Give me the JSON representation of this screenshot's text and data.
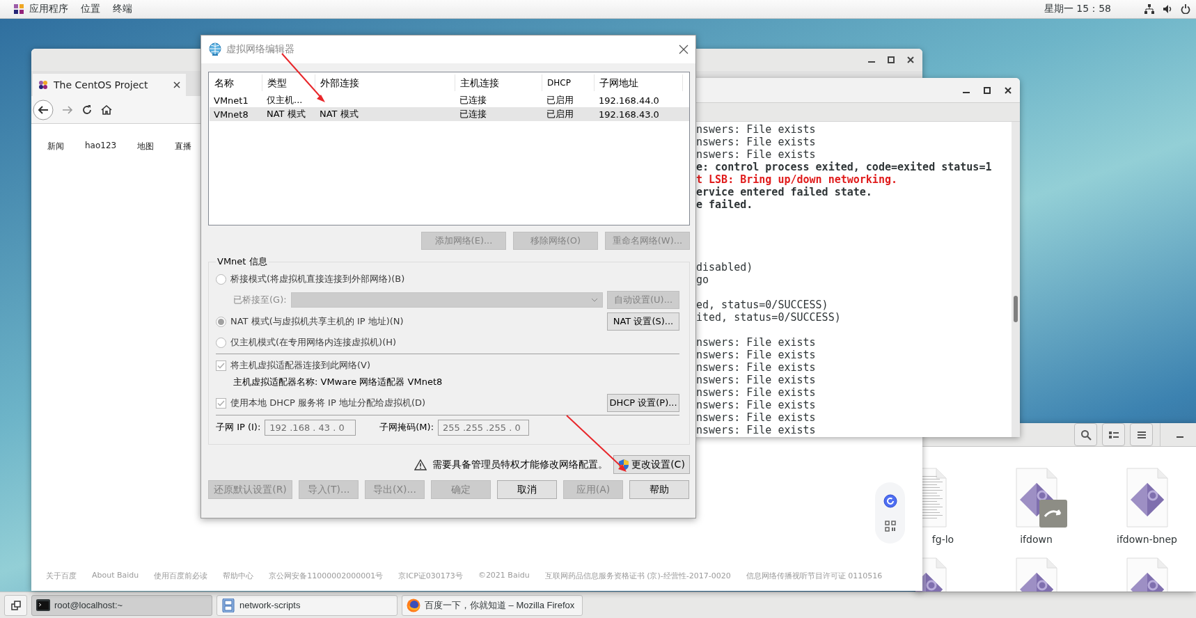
{
  "top_bar": {
    "menus": [
      "应用程序",
      "位置",
      "终端"
    ],
    "clock": "星期一 15：58"
  },
  "browser": {
    "tabs": [
      {
        "label": "The CentOS Project",
        "selected": true
      }
    ],
    "links": [
      "新闻",
      "hao123",
      "地图",
      "直播"
    ],
    "footer_links": [
      "关于百度",
      "About Baidu",
      "使用百度前必读",
      "帮助中心",
      "京公网安备11000002000001号",
      "京ICP证030173号",
      "©2021 Baidu",
      "互联网药品信息服务资格证书 (京)-经营性-2017-0020",
      "信息网络传播视听节目许可证 0110516"
    ]
  },
  "terminal": {
    "lines": [
      {
        "kind": "normal",
        "text": "nswers: File exists"
      },
      {
        "kind": "normal",
        "text": "nswers: File exists"
      },
      {
        "kind": "normal",
        "text": "nswers: File exists"
      },
      {
        "kind": "bold",
        "text": "e: control process exited, code=exited status=1"
      },
      {
        "kind": "error",
        "text": "t LSB: Bring up/down networking."
      },
      {
        "kind": "bold",
        "text": "ervice entered failed state."
      },
      {
        "kind": "bold",
        "text": "e failed."
      },
      {
        "kind": "blank"
      },
      {
        "kind": "blank"
      },
      {
        "kind": "blank"
      },
      {
        "kind": "blank"
      },
      {
        "kind": "normal",
        "text": "disabled)"
      },
      {
        "kind": "normal",
        "text": "go"
      },
      {
        "kind": "blank"
      },
      {
        "kind": "normal",
        "text": "ed, status=0/SUCCESS)"
      },
      {
        "kind": "normal",
        "text": "ited, status=0/SUCCESS)"
      },
      {
        "kind": "blank"
      },
      {
        "kind": "normal",
        "text": "nswers: File exists"
      },
      {
        "kind": "normal",
        "text": "nswers: File exists"
      },
      {
        "kind": "normal",
        "text": "nswers: File exists"
      },
      {
        "kind": "normal",
        "text": "nswers: File exists"
      },
      {
        "kind": "normal",
        "text": "nswers: File exists"
      },
      {
        "kind": "normal",
        "text": "nswers: File exists"
      },
      {
        "kind": "normal",
        "text": "nswers: File exists"
      },
      {
        "kind": "normal",
        "text": "nswers: File exists"
      }
    ]
  },
  "file_manager": {
    "items": [
      {
        "kind": "text",
        "label": "fg-lo"
      },
      {
        "kind": "link",
        "label": "ifdown"
      },
      {
        "kind": "script",
        "label": "ifdown-bnep"
      }
    ]
  },
  "dialog": {
    "title": "虚拟网络编辑器",
    "table": {
      "columns": [
        "名称",
        "类型",
        "外部连接",
        "主机连接",
        "DHCP",
        "子网地址"
      ],
      "rows": [
        {
          "name": "VMnet1",
          "type": "仅主机...",
          "host": "已连接",
          "dhcp": "已启用",
          "subnet": "192.168.44.0",
          "selected": false
        },
        {
          "name": "VMnet8",
          "type": "NAT 模式",
          "external": "NAT 模式",
          "host": "已连接",
          "dhcp": "已启用",
          "subnet": "192.168.43.0",
          "selected": true
        }
      ]
    },
    "list_buttons": [
      {
        "label": "添加网络(E)...",
        "disabled": true
      },
      {
        "label": "移除网络(O)",
        "disabled": true
      },
      {
        "label": "重命名网络(W)...",
        "disabled": true
      }
    ],
    "group": {
      "title": "VMnet 信息",
      "modes": [
        {
          "label": "桥接模式(将虚拟机直接连接到外部网络)(B)",
          "selected": false
        },
        {
          "label": "NAT 模式(与虚拟机共享主机的 IP 地址)(N)",
          "selected": true
        },
        {
          "label": "仅主机模式(在专用网络内连接虚拟机)(H)",
          "selected": false
        }
      ],
      "bridge_label": "已桥接至(G):",
      "bridge_disabled": true,
      "auto_button": {
        "label": "自动设置(U)...",
        "disabled": true
      },
      "nat_button": {
        "label": "NAT 设置(S)...",
        "disabled": false
      },
      "host_adapter": {
        "label": "将主机虚拟适配器连接到此网络(V)",
        "checked": true,
        "disabled": true
      },
      "adapter_name": "主机虚拟适配器名称: VMware 网络适配器 VMnet8",
      "dhcp": {
        "label": "使用本地 DHCP 服务将 IP 地址分配给虚拟机(D)",
        "checked": true,
        "disabled": true
      },
      "dhcp_button": {
        "label": "DHCP 设置(P)...",
        "disabled": false
      },
      "subnet_ip": {
        "label": "子网 IP (I):",
        "value": "192 .168 . 43 . 0"
      },
      "subnet_mask": {
        "label": "子网掩码(M):",
        "value": "255 .255 .255 . 0"
      }
    },
    "warning": "需要具备管理员特权才能修改网络配置。",
    "change_button": "更改设置(C)",
    "buttons": [
      {
        "label": "还原默认设置(R)",
        "disabled": true
      },
      {
        "label": "导入(T)...",
        "disabled": true
      },
      {
        "label": "导出(X)...",
        "disabled": true
      },
      {
        "label": "确定",
        "disabled": true
      },
      {
        "label": "取消",
        "disabled": false
      },
      {
        "label": "应用(A)",
        "disabled": true
      },
      {
        "label": "帮助",
        "disabled": false
      }
    ]
  },
  "taskbar": {
    "items": [
      {
        "kind": "terminal",
        "label": "root@localhost:~",
        "selected": true
      },
      {
        "kind": "files",
        "label": "network-scripts",
        "selected": false
      },
      {
        "kind": "browser",
        "label": "百度一下，你就知道 – Mozilla Firefox",
        "selected": false
      }
    ]
  }
}
